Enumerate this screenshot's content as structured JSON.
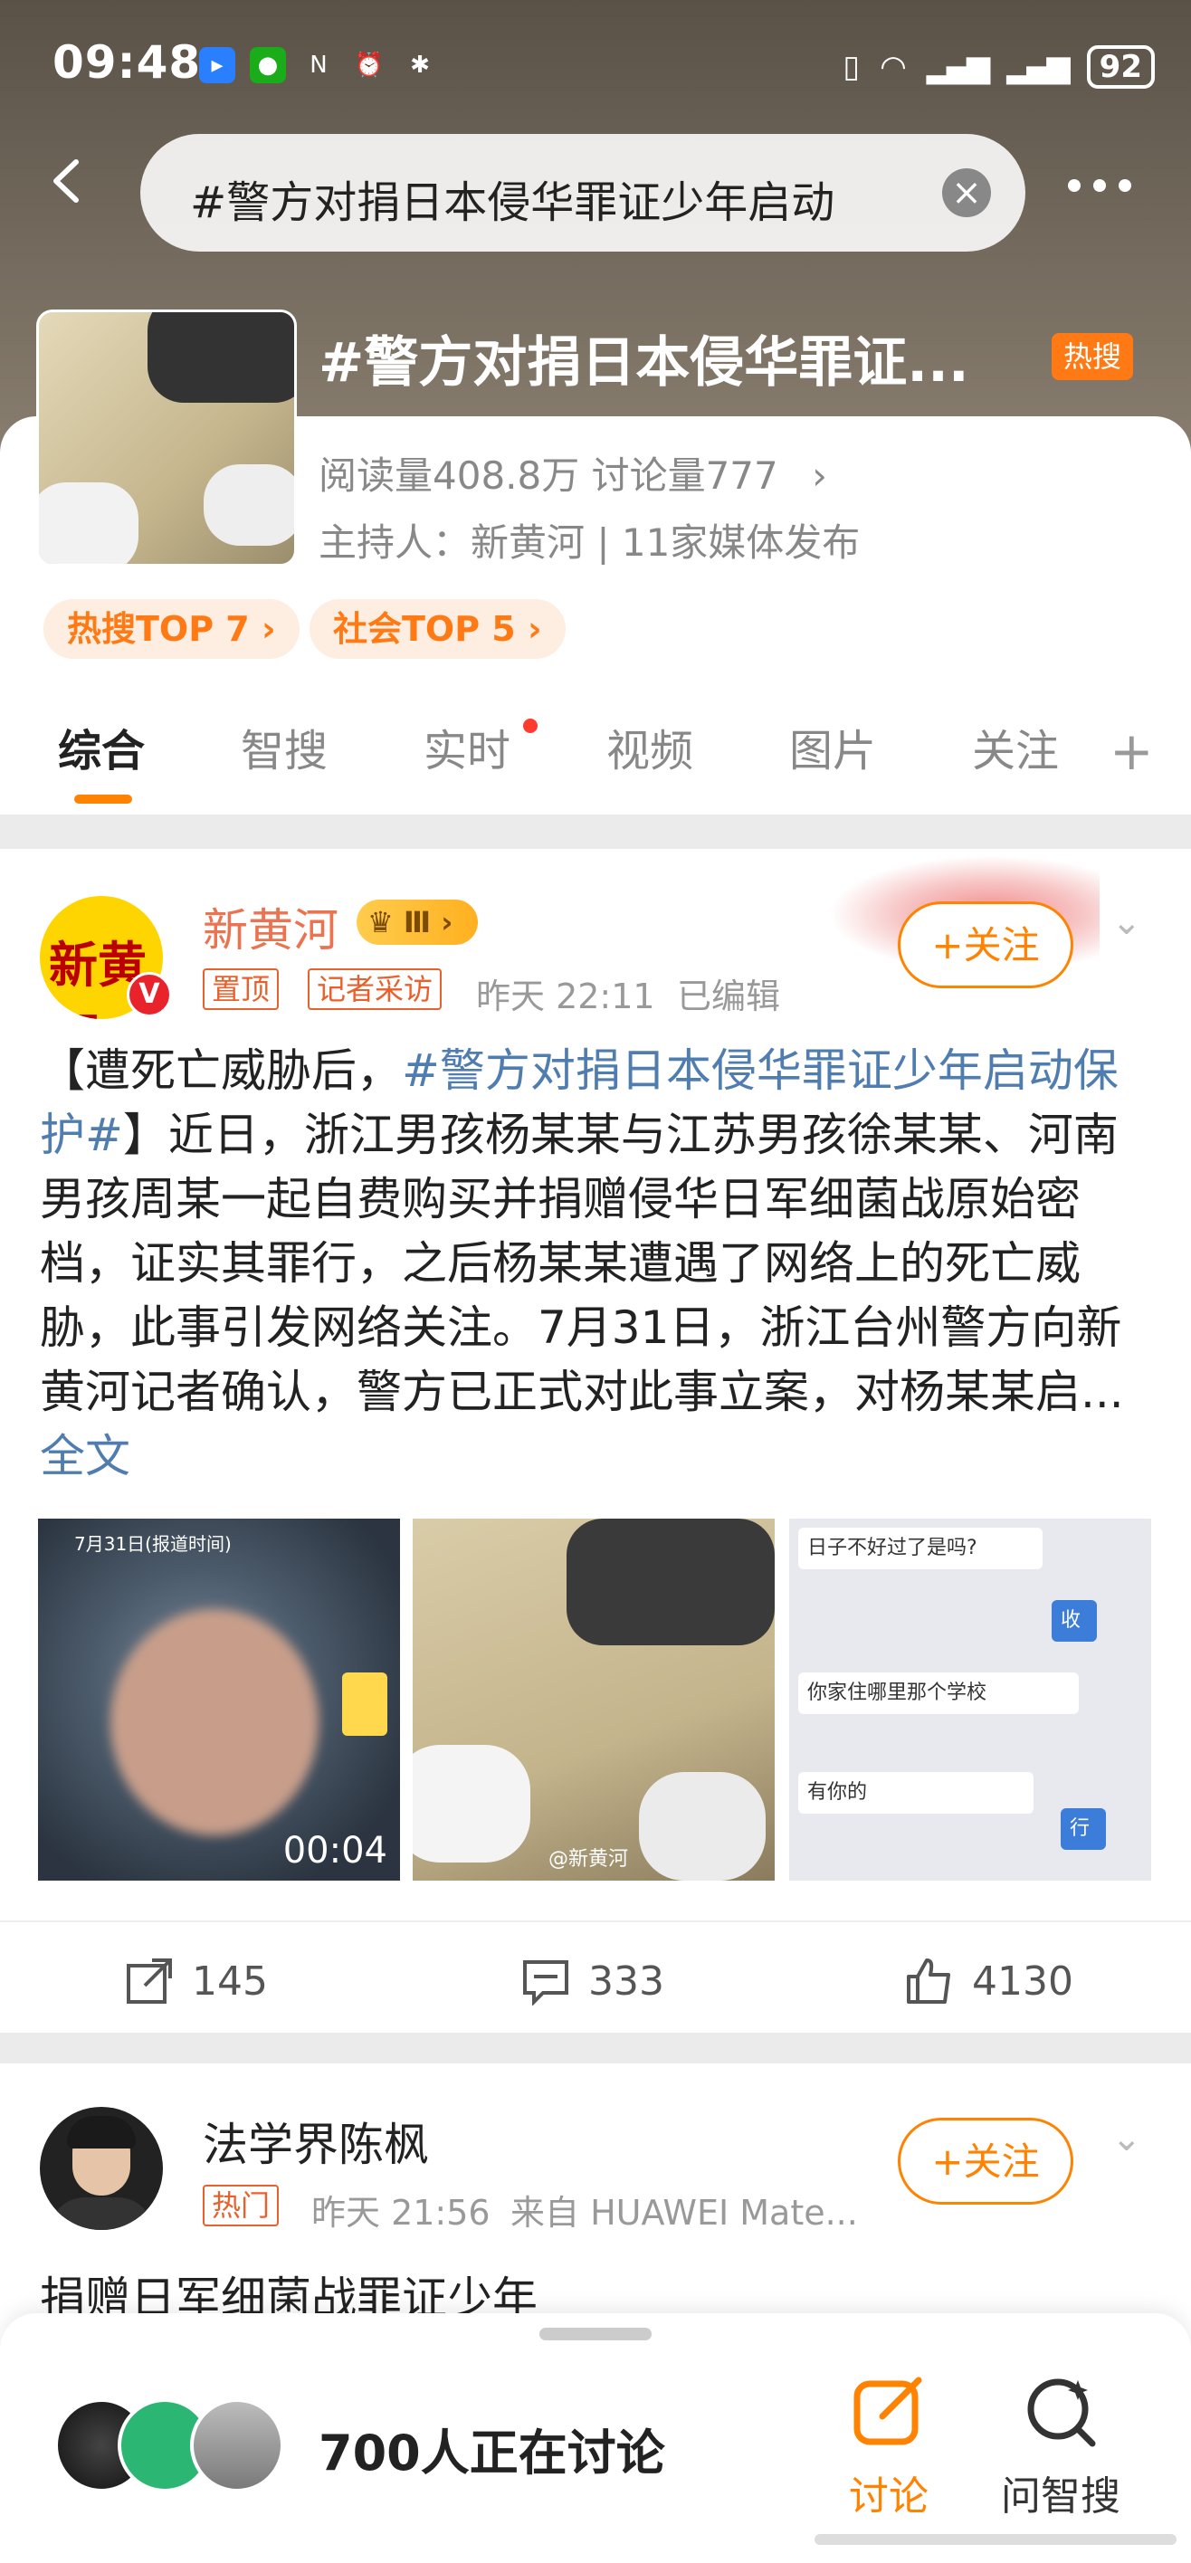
{
  "status_bar": {
    "time": "09:48",
    "battery": "92",
    "network": "6"
  },
  "search": {
    "query": "#警方对捐日本侵华罪证少年启动"
  },
  "topic": {
    "title": "#警方对捐日本侵华罪证...",
    "hot_badge": "热搜",
    "stats": "阅读量408.8万  讨论量777",
    "host": "主持人：新黄河 | 11家媒体发布",
    "rank_pills": [
      "热搜TOP 7 ›",
      "社会TOP 5 ›"
    ]
  },
  "tabs": [
    "综合",
    "智搜",
    "实时",
    "视频",
    "图片",
    "关注"
  ],
  "post1": {
    "author": "新黄河",
    "level_badge": "Ⅲ",
    "tags": [
      "置顶",
      "记者采访"
    ],
    "time": "昨天 22:11",
    "edited": "已编辑",
    "follow_label": "+关注",
    "text_prefix": "【遭死亡威胁后，",
    "text_hashtag": "#警方对捐日本侵华罪证少年启动保护#",
    "text_body": "】近日，浙江男孩杨某某与江苏男孩徐某某、河南男孩周某一起自费购买并捐赠侵华日军细菌战原始密档，证实其罪行，之后杨某某遭遇了网络上的死亡威胁，此事引发网络关注。7月31日，浙江台州警方向新黄河记者确认，警方已正式对此事立案，对杨某某启...",
    "read_more": "全文",
    "video_duration": "00:04",
    "image2_watermark": "@新黄河",
    "shares": "145",
    "comments": "333",
    "likes": "4130"
  },
  "post2": {
    "author": "法学界陈枫",
    "tag": "热门",
    "time": "昨天 21:56",
    "source": "来自 HUAWEI Mate...",
    "follow_label": "+关注",
    "text": "捐赠日军细菌战罪证少年"
  },
  "bottom_sheet": {
    "discussing": "700人正在讨论",
    "discuss_btn": "讨论",
    "ask_btn": "问智搜"
  },
  "colors": {
    "accent": "#ff8200",
    "link": "#507daf",
    "hot": "#ff7a14"
  }
}
